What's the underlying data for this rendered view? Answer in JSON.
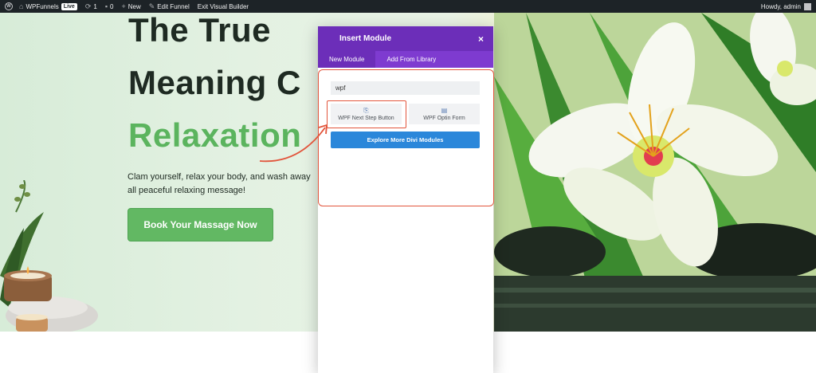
{
  "adminbar": {
    "site_name": "WPFunnels",
    "live_badge": "Live",
    "updates_count": "1",
    "comments_count": "0",
    "new_label": "New",
    "edit_funnel_label": "Edit Funnel",
    "exit_builder_label": "Exit Visual Builder",
    "howdy_label": "Howdy, admin"
  },
  "hero": {
    "title_line1": "The True",
    "title_line2": "Meaning C",
    "title_line3": "Relaxation",
    "description": "Clam yourself, relax your body, and wash away all peaceful relaxing message!",
    "cta_label": "Book Your Massage Now"
  },
  "insert_module": {
    "title": "Insert Module",
    "close_icon": "×",
    "tabs": [
      {
        "label": "New Module",
        "active": true
      },
      {
        "label": "Add From Library",
        "active": false
      }
    ],
    "search_value": "wpf",
    "modules": [
      {
        "label": "WPF Next Step Button",
        "icon": "link-icon"
      },
      {
        "label": "WPF Optin Form",
        "icon": "form-icon"
      }
    ],
    "explore_label": "Explore More Divi Modules"
  },
  "colors": {
    "adminbar_bg": "#1d2327",
    "modal_header": "#6c2eb9",
    "modal_tabs": "#7e3bd0",
    "explore_button": "#2b87da",
    "cta_green": "#62b863",
    "title_green": "#5bb45e",
    "highlight": "#e2553c"
  }
}
